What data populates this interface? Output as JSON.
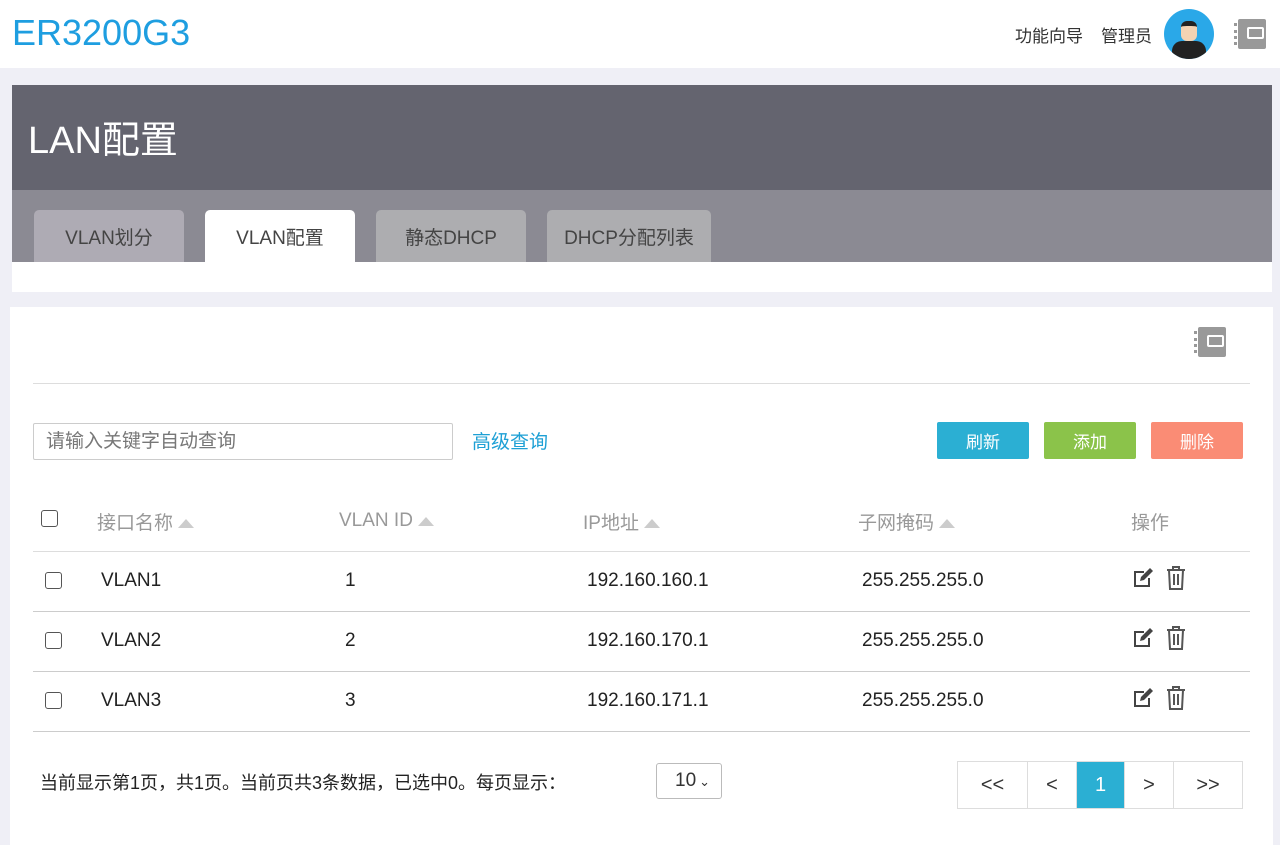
{
  "brand": "ER3200G3",
  "top": {
    "wizard": "功能向导",
    "admin": "管理员"
  },
  "page_title": "LAN配置",
  "tabs": [
    {
      "label": "VLAN划分"
    },
    {
      "label": "VLAN配置"
    },
    {
      "label": "静态DHCP"
    },
    {
      "label": "DHCP分配列表"
    }
  ],
  "search": {
    "placeholder": "请输入关键字自动查询"
  },
  "advanced": "高级查询",
  "buttons": {
    "refresh": "刷新",
    "add": "添加",
    "delete": "删除"
  },
  "colors": {
    "refresh": "#2bafd3",
    "add": "#8bc34a",
    "delete": "#fa8c75",
    "accent": "#1e9ee0"
  },
  "table": {
    "headers": [
      "接口名称",
      "VLAN ID",
      "IP地址",
      "子网掩码",
      "操作"
    ],
    "rows": [
      {
        "name": "VLAN1",
        "id": "1",
        "ip": "192.160.160.1",
        "mask": "255.255.255.0"
      },
      {
        "name": "VLAN2",
        "id": "2",
        "ip": "192.160.170.1",
        "mask": "255.255.255.0"
      },
      {
        "name": "VLAN3",
        "id": "3",
        "ip": "192.160.171.1",
        "mask": "255.255.255.0"
      }
    ]
  },
  "footer": {
    "status": "当前显示第1页，共1页。当前页共3条数据，已选中0。每页显示：",
    "page_size": "10"
  },
  "pager": {
    "first": "<<",
    "prev": "<",
    "current": "1",
    "next": ">",
    "last": ">>"
  }
}
